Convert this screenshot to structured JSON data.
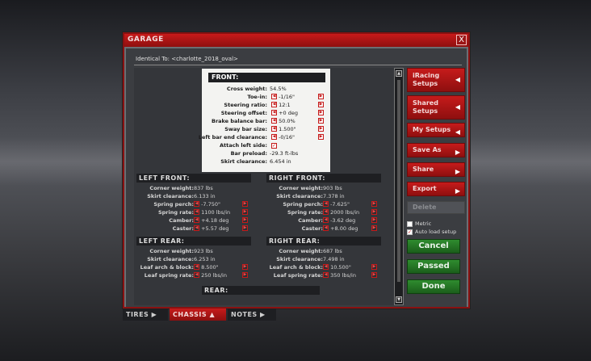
{
  "window": {
    "title": "GARAGE",
    "close_glyph": "X"
  },
  "identical_to": "Identical To: <charlotte_2018_oval>",
  "front": {
    "header": "FRONT:",
    "rows": [
      {
        "label": "Cross weight:",
        "value": "54.5%"
      },
      {
        "label": "Toe-in:",
        "value": "-1/16\""
      },
      {
        "label": "Steering ratio:",
        "value": "12:1"
      },
      {
        "label": "Steering offset:",
        "value": "+0 deg"
      },
      {
        "label": "Brake balance bar:",
        "value": "50.0%"
      },
      {
        "label": "Sway bar size:",
        "value": "1.500\""
      },
      {
        "label": "Left bar end clearance:",
        "value": "-0/16\""
      },
      {
        "label": "Attach left side:",
        "value": "✓"
      },
      {
        "label": "Bar preload:",
        "value": "-29.3 ft-lbs"
      },
      {
        "label": "Skirt clearance:",
        "value": "6.454 in"
      }
    ]
  },
  "left_front": {
    "header": "LEFT FRONT:",
    "rows": [
      {
        "label": "Corner weight:",
        "value": "837 lbs"
      },
      {
        "label": "Skirt clearance:",
        "value": "6.133 in"
      },
      {
        "label": "Spring perch:",
        "value": "-7.750\""
      },
      {
        "label": "Spring rate:",
        "value": "1100 lbs/in"
      },
      {
        "label": "Camber:",
        "value": "+4.18 deg"
      },
      {
        "label": "Caster:",
        "value": "+5.57 deg"
      }
    ]
  },
  "right_front": {
    "header": "RIGHT FRONT:",
    "rows": [
      {
        "label": "Corner weight:",
        "value": "903 lbs"
      },
      {
        "label": "Skirt clearance:",
        "value": "7.378 in"
      },
      {
        "label": "Spring perch:",
        "value": "-7.625\""
      },
      {
        "label": "Spring rate:",
        "value": "2000 lbs/in"
      },
      {
        "label": "Camber:",
        "value": "-3.62 deg"
      },
      {
        "label": "Caster:",
        "value": "+8.00 deg"
      }
    ]
  },
  "left_rear": {
    "header": "LEFT REAR:",
    "rows": [
      {
        "label": "Corner weight:",
        "value": "923 lbs"
      },
      {
        "label": "Skirt clearance:",
        "value": "6.253 in"
      },
      {
        "label": "Leaf arch & block:",
        "value": "8.500\""
      },
      {
        "label": "Leaf spring rate:",
        "value": "250 lbs/in"
      }
    ]
  },
  "right_rear": {
    "header": "RIGHT REAR:",
    "rows": [
      {
        "label": "Corner weight:",
        "value": "687 lbs"
      },
      {
        "label": "Skirt clearance:",
        "value": "7.498 in"
      },
      {
        "label": "Leaf arch & block:",
        "value": "10.500\""
      },
      {
        "label": "Leaf spring rate:",
        "value": "350 lbs/in"
      }
    ]
  },
  "rear": {
    "header": "REAR:"
  },
  "sidebar": {
    "iracing_setups_1": "iRacing",
    "iracing_setups_2": "Setups",
    "shared_setups_1": "Shared",
    "shared_setups_2": "Setups",
    "my_setups": "My Setups",
    "save_as": "Save As",
    "share": "Share",
    "export": "Export",
    "delete": "Delete",
    "metric": "Metric",
    "auto_load": "Auto load setup",
    "cancel": "Cancel",
    "passed": "Passed",
    "done": "Done"
  },
  "tabs": {
    "tires": "TIRES ▶",
    "chassis": "CHASSIS ▲",
    "notes": "NOTES ▶"
  },
  "icons": {
    "left": "◀",
    "right": "▶",
    "up": "▲",
    "down": "▼",
    "check": "✓"
  },
  "colors": {
    "accent": "#c61b1b",
    "green": "#2f8c2f",
    "panel": "#3b3d41"
  }
}
